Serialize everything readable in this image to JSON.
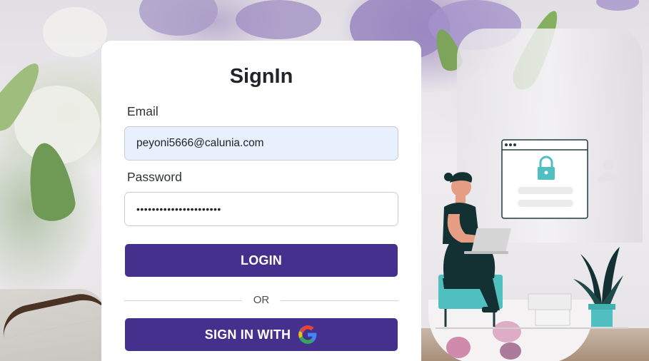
{
  "form": {
    "title": "SignIn",
    "email_label": "Email",
    "email_value": "peyoni5666@calunia.com",
    "password_label": "Password",
    "password_value": "••••••••••••••••••••••",
    "login_button": "LOGIN",
    "divider_text": "OR",
    "google_button": "SIGN IN WITH"
  },
  "icons": {
    "google": "google-g-icon",
    "lock": "lock-icon",
    "user": "user-icon"
  },
  "colors": {
    "primary_button": "#45308e",
    "email_field_bg": "#e8f0fe",
    "card_bg": "#ffffff",
    "illustration_teal": "#4fbfbf"
  }
}
